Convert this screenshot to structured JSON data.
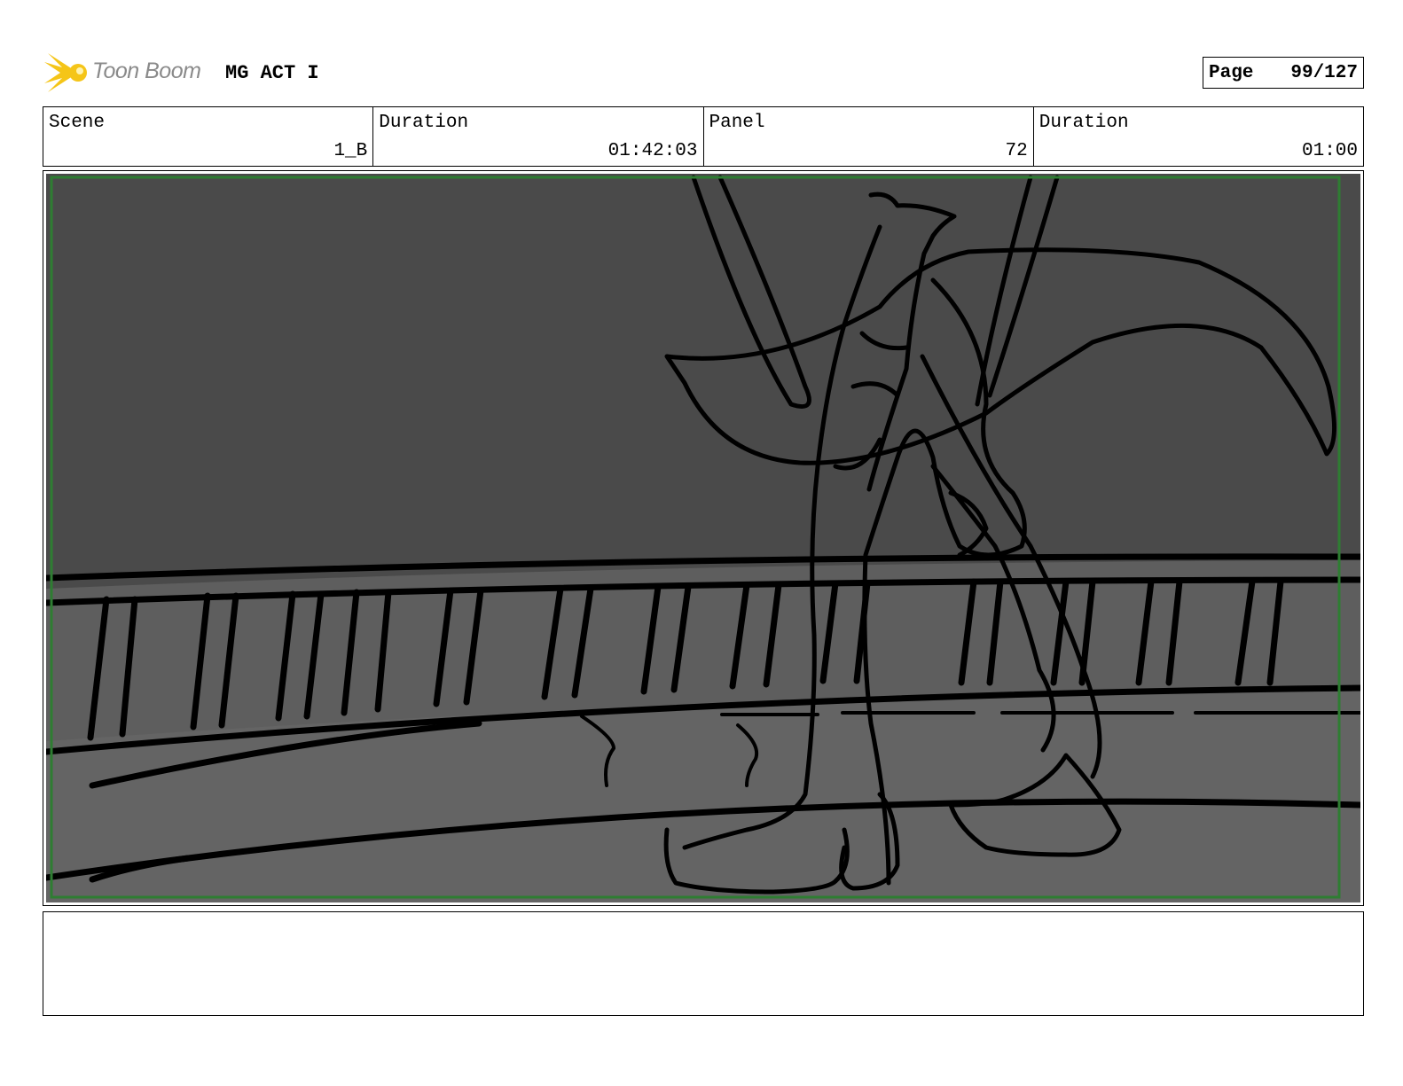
{
  "header": {
    "brand": "Toon Boom",
    "project_title": "MG ACT I",
    "page_label": "Page",
    "page_number": "99/127"
  },
  "info": {
    "scene_label": "Scene",
    "scene_value": "1_B",
    "scene_duration_label": "Duration",
    "scene_duration_value": "01:42:03",
    "panel_label": "Panel",
    "panel_value": "72",
    "panel_duration_label": "Duration",
    "panel_duration_value": "01:00"
  },
  "colors": {
    "logo_star": "#f5c518",
    "safe_frame": "#2e7d32",
    "sky": "#4a4a4a",
    "ground": "#626262"
  },
  "icons": {
    "logo": "toon-boom-starburst-icon"
  },
  "notes": {
    "text": ""
  }
}
